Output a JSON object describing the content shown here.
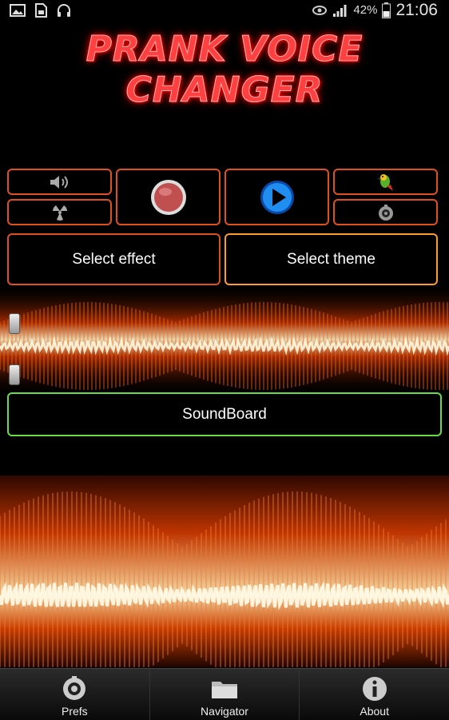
{
  "status_bar": {
    "battery": "42%",
    "time": "21:06"
  },
  "app": {
    "title": "PRANK VOICE CHANGER"
  },
  "controls": {
    "select_effect": "Select effect",
    "select_theme": "Select theme",
    "soundboard": "SoundBoard"
  },
  "bottom_nav": {
    "items": [
      {
        "label": "Prefs",
        "icon": "gear-icon"
      },
      {
        "label": "Navigator",
        "icon": "folder-icon"
      },
      {
        "label": "About",
        "icon": "info-icon"
      }
    ]
  },
  "colors": {
    "accent_orange": "#e0501c",
    "accent_orange_light": "#ff9b2a",
    "accent_green": "#66dd44",
    "title_red": "#ff4040"
  }
}
